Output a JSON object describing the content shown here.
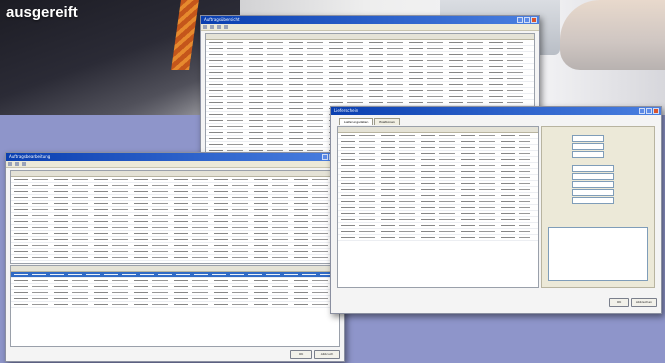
{
  "headline": "ausgereift",
  "windows": {
    "back": {
      "title": "Auftragsübersicht"
    },
    "left": {
      "title": "Auftragsbearbeitung",
      "buttons": [
        "OK",
        "Abbruch"
      ]
    },
    "right": {
      "title": "Lieferschein",
      "tabs": [
        "Lieferungsdaten",
        "Positionen"
      ],
      "buttons": [
        "OK",
        "Abbrechen"
      ]
    }
  },
  "icons": [
    "minimize-icon",
    "maximize-icon",
    "close-icon"
  ],
  "colors": {
    "titlebar": "#0a3fb0",
    "selection": "#316ac5",
    "background": "#8e95ca"
  }
}
